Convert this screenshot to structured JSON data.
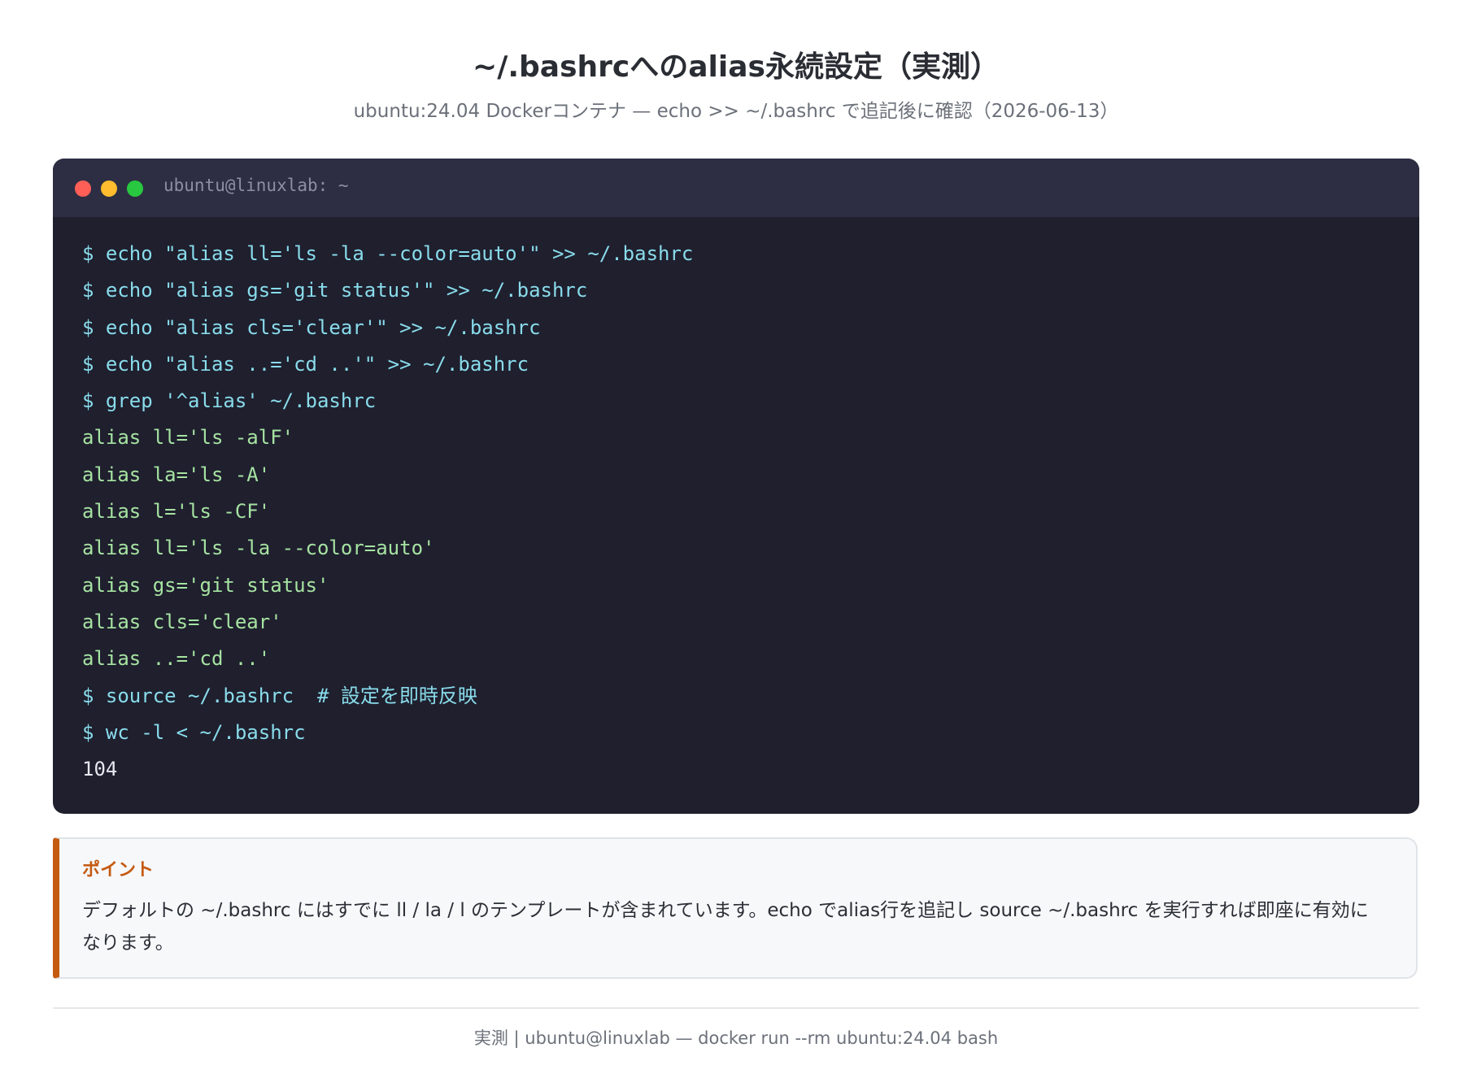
{
  "header": {
    "title": "~/.bashrcへのalias永続設定（実測）",
    "subtitle": "ubuntu:24.04 Dockerコンテナ — echo >> ~/.bashrc で追記後に確認（2026-06-13）"
  },
  "terminal": {
    "window_title": "ubuntu@linuxlab: ~",
    "controls": {
      "close_color": "#ff5f57",
      "minimize_color": "#febc2e",
      "maximize_color": "#28c840"
    },
    "lines": [
      "$ echo \"alias ll='ls -la --color=auto'\" >> ~/.bashrc",
      "$ echo \"alias gs='git status'\" >> ~/.bashrc",
      "$ echo \"alias cls='clear'\" >> ~/.bashrc",
      "$ echo \"alias ..='cd ..'\" >> ~/.bashrc",
      "$ grep '^alias' ~/.bashrc",
      "alias ll='ls -alF'",
      "alias la='ls -A'",
      "alias l='ls -CF'",
      "alias ll='ls -la --color=auto'",
      "alias gs='git status'",
      "alias cls='clear'",
      "alias ..='cd ..'",
      "$ source ~/.bashrc  # 設定を即時反映",
      "$ wc -l < ~/.bashrc",
      "104"
    ]
  },
  "callout": {
    "title": "ポイント",
    "text": "デフォルトの ~/.bashrc にはすでに ll / la / l のテンプレートが含まれています。echo でalias行を追記し source ~/.bashrc を実行すれば即座に有効になります。"
  },
  "footer": {
    "text": "実測 | ubuntu@linuxlab — docker run --rm ubuntu:24.04 bash"
  },
  "colors": {
    "terminal_bg": "#1f1f2e",
    "command": "#89dceb",
    "output": "#a6e3a1",
    "accent": "#c55a11"
  }
}
